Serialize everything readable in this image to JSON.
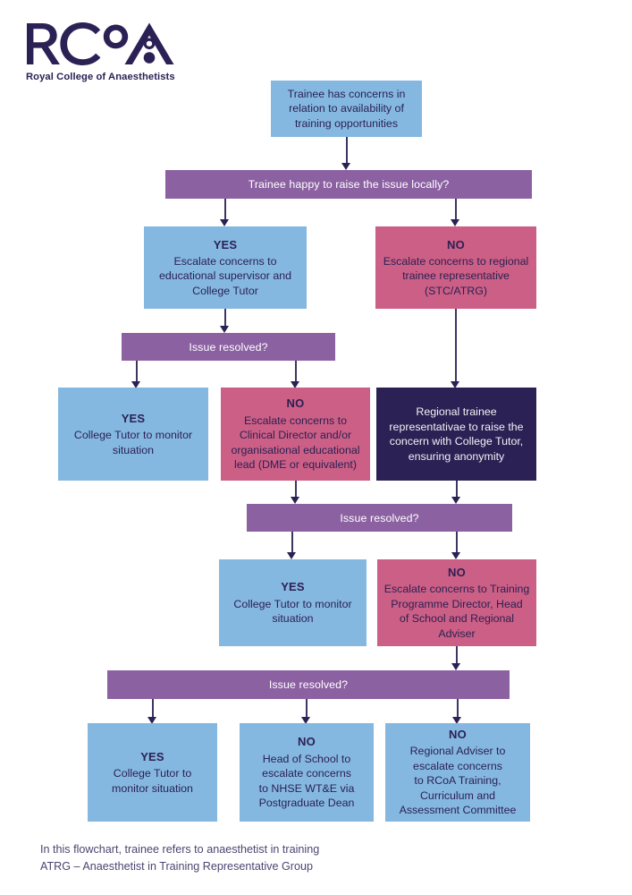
{
  "logo": {
    "mark_text": "RCoA",
    "subtitle": "Royal College of Anaesthetists"
  },
  "colors": {
    "blue": "#85b8e0",
    "pink": "#cc5f85",
    "navy": "#2b2154",
    "purple": "#8c61a2",
    "connector": "#3c3663",
    "background": "#ffffff",
    "text_dark": "#2b2154",
    "footnote": "#4b4570"
  },
  "flow": {
    "start": {
      "title": "",
      "body": "Trainee has concerns in\nrelation to availability of\ntraining opportunities"
    },
    "decision1": {
      "label": "Trainee happy to raise the issue locally?"
    },
    "row1": [
      {
        "title": "YES",
        "body": "Escalate concerns to\neducational supervisor and\nCollege Tutor"
      },
      {
        "title": "NO",
        "body": "Escalate concerns to regional\ntrainee representative\n(STC/ATRG)"
      }
    ],
    "decision2": {
      "label": "Issue resolved?"
    },
    "row2": [
      {
        "title": "YES",
        "body": "College Tutor to monitor\nsituation"
      },
      {
        "title": "NO",
        "body": "Escalate concerns to\nClinical Director and/or\norganisational educational\nlead (DME or equivalent)"
      },
      {
        "title": "",
        "body": "Regional trainee\nrepresentativae to raise the\nconcern with College Tutor,\nensuring anonymity"
      }
    ],
    "decision3": {
      "label": "Issue resolved?"
    },
    "row3": [
      {
        "title": "YES",
        "body": "College Tutor to monitor\nsituation"
      },
      {
        "title": "NO",
        "body": "Escalate concerns to Training\nProgramme Director, Head\nof School and Regional\nAdviser"
      }
    ],
    "decision4": {
      "label": "Issue resolved?"
    },
    "row4": [
      {
        "title": "YES",
        "body": "College Tutor to\nmonitor situation"
      },
      {
        "title": "NO",
        "body": "Head of School to\nescalate concerns\nto NHSE WT&E via\nPostgraduate Dean"
      },
      {
        "title": "NO",
        "body": "Regional Adviser to\nescalate concerns\nto RCoA Training,\nCurriculum and\nAssessment Committee"
      }
    ]
  },
  "footnote": {
    "text": "In this flowchart, trainee refers to anaesthetist in training\nATRG – Anaesthetist in Training Representative Group"
  }
}
